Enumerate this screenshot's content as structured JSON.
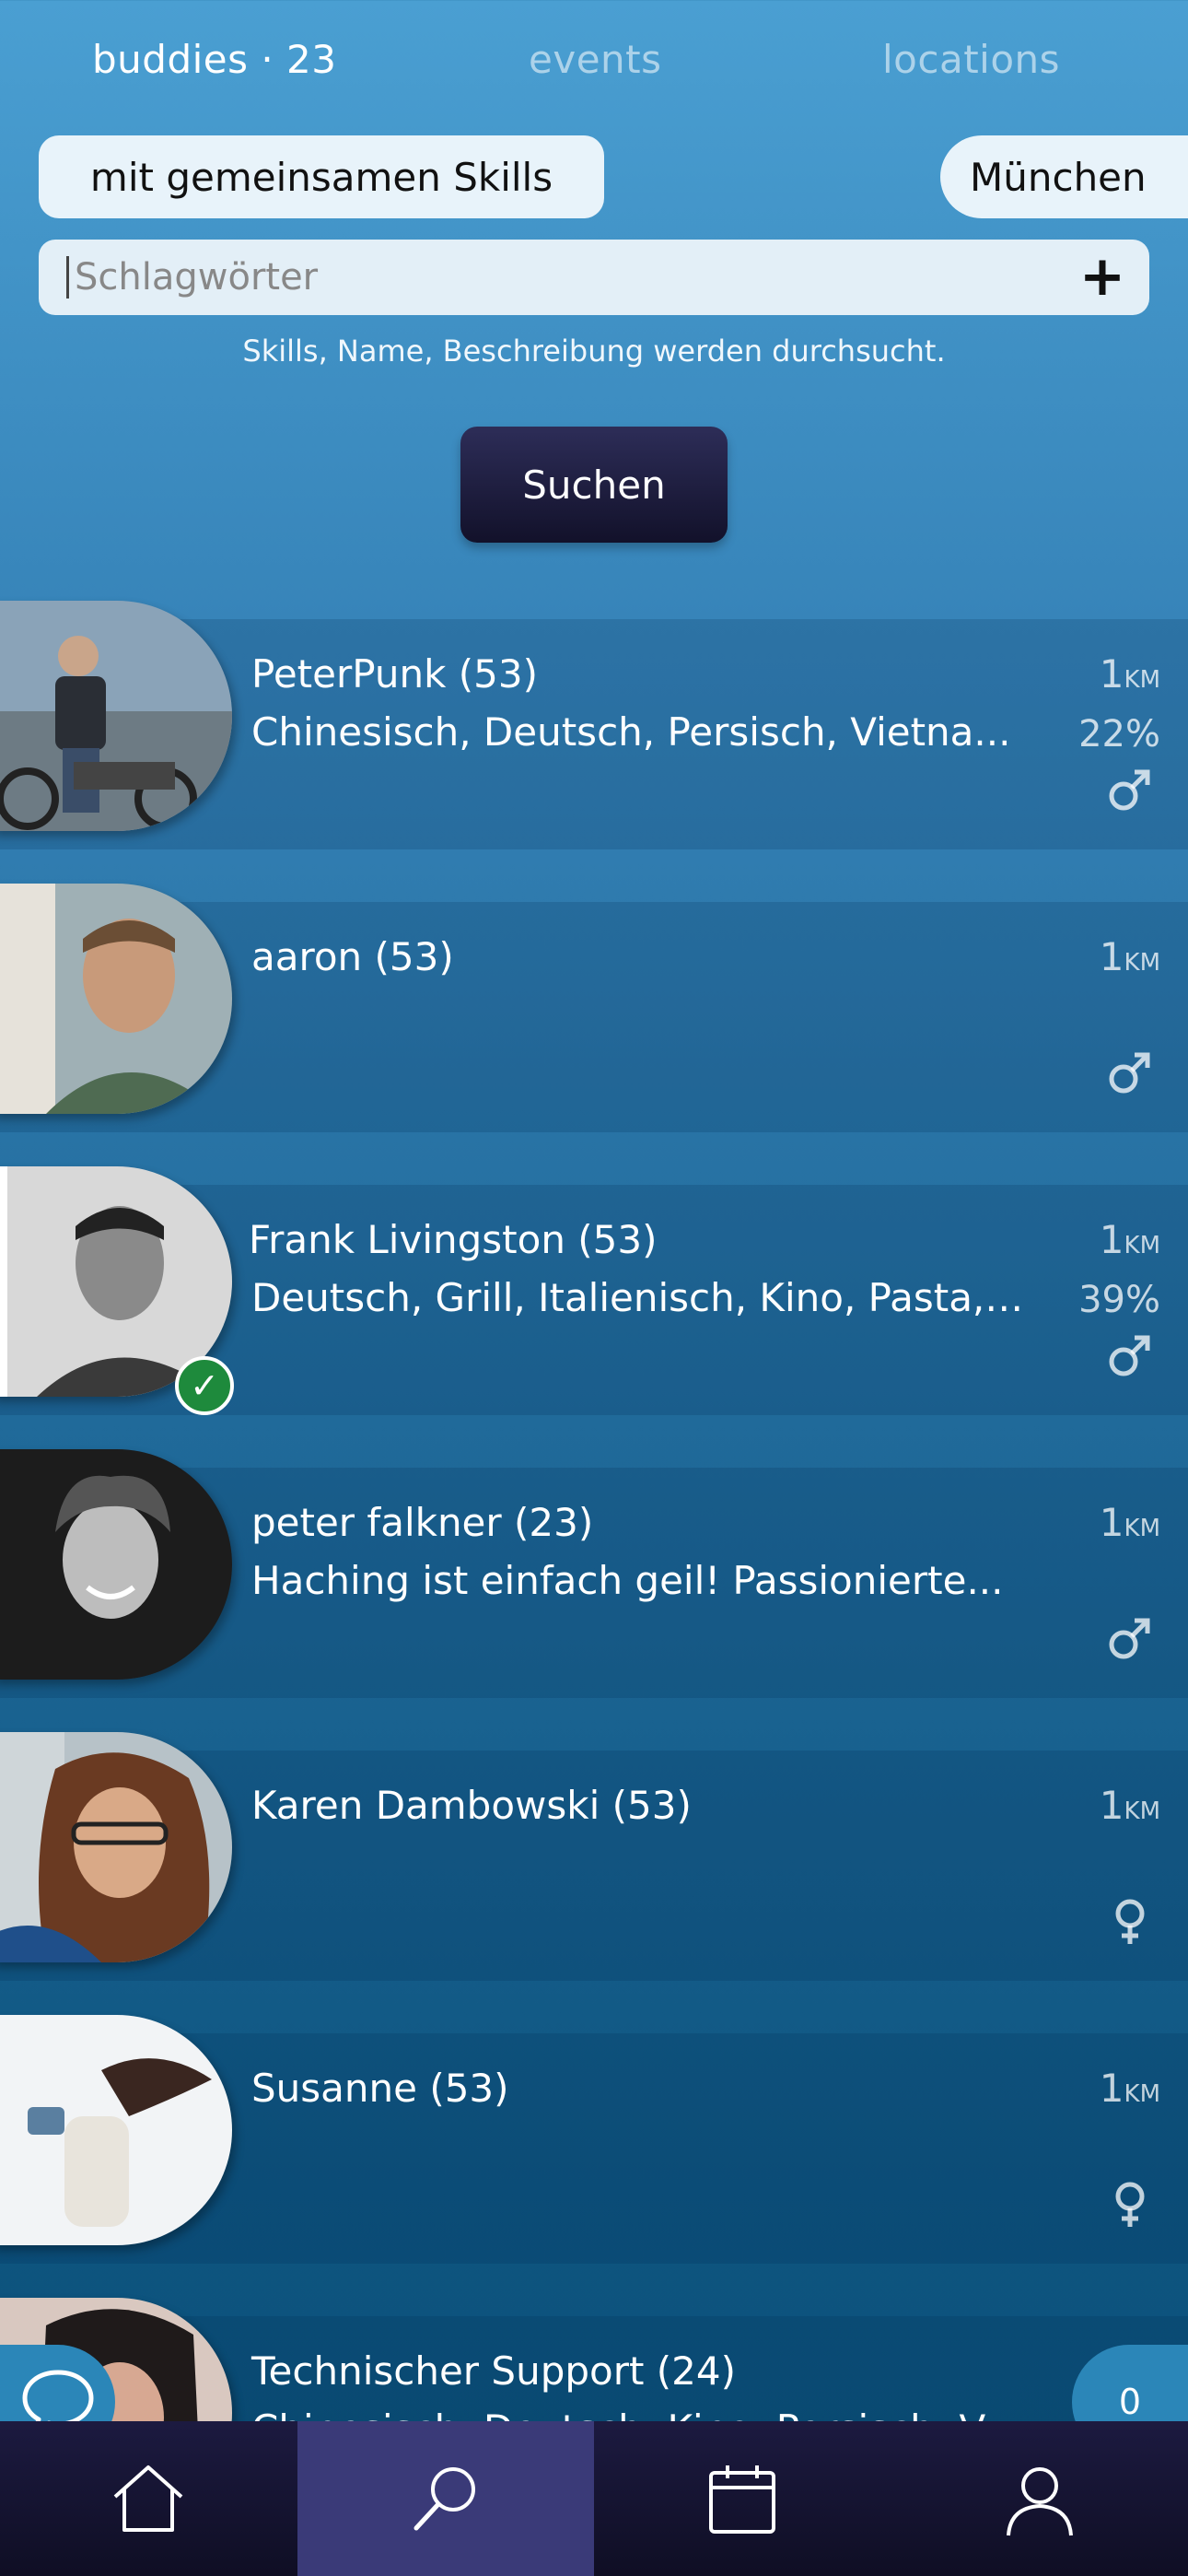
{
  "tabs": {
    "buddies": "buddies · 23",
    "events": "events",
    "locations": "locations"
  },
  "filters": {
    "skills": "mit gemeinsamen Skills",
    "city": "München"
  },
  "search": {
    "placeholder": "Schlagwörter",
    "plus_label": "+",
    "hint": "Skills, Name, Beschreibung werden durchsucht.",
    "button_label": "Suchen"
  },
  "results": [
    {
      "name": "PeterPunk (53)",
      "desc": "Chinesisch, Deutsch, Persisch, Vietna...",
      "dist": "1",
      "unit": "KM",
      "match": "22%",
      "gender": "male"
    },
    {
      "name": "aaron (53)",
      "desc": "",
      "dist": "1",
      "unit": "KM",
      "match": "",
      "gender": "male"
    },
    {
      "name": "Frank Livingston (53)",
      "desc": "Deutsch, Grill, Italienisch, Kino, Pasta, ...",
      "dist": "1",
      "unit": "KM",
      "match": "39%",
      "gender": "male",
      "verified": "✓"
    },
    {
      "name": "peter falkner (23)",
      "desc": "Haching ist einfach geil! Passionierte...",
      "dist": "1",
      "unit": "KM",
      "match": "",
      "gender": "male"
    },
    {
      "name": "Karen Dambowski (53)",
      "desc": "",
      "dist": "1",
      "unit": "KM",
      "match": "",
      "gender": "female"
    },
    {
      "name": "Susanne (53)",
      "desc": "",
      "dist": "1",
      "unit": "KM",
      "match": "",
      "gender": "female"
    },
    {
      "name": "Technischer Support (24)",
      "desc": "Chinesisch, Deutsch, Kino, Persisch, V...",
      "dist": "",
      "unit": "",
      "match": "",
      "gender": ""
    }
  ],
  "floating": {
    "chat_icon": "chat-bubble-icon",
    "count": "0"
  },
  "nav": {
    "items": [
      "home-icon",
      "search-icon",
      "calendar-icon",
      "profile-icon"
    ],
    "active": "search-icon"
  },
  "colors": {
    "accent_dark": "#12112a",
    "nav_active": "#3a3a78",
    "verified": "#1e8a3c",
    "bubble": "#2b86b8"
  }
}
